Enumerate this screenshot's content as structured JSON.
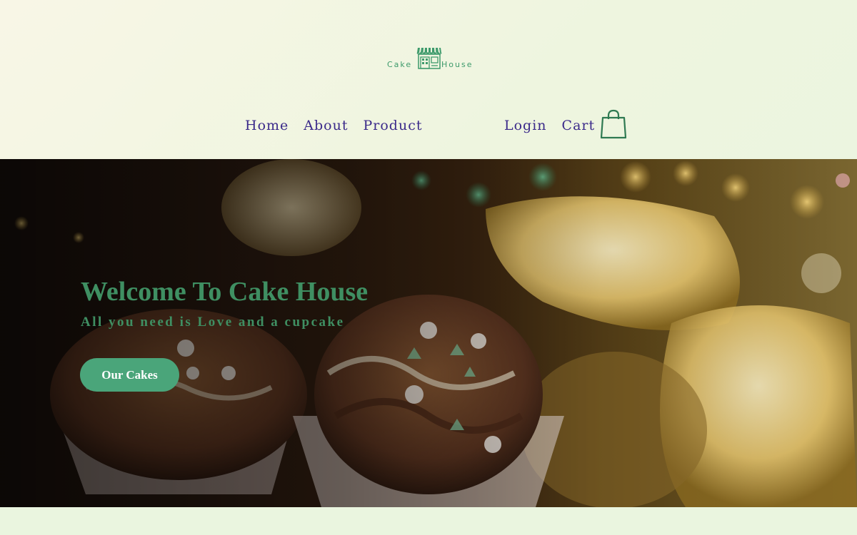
{
  "logo": {
    "left_word": "Cake",
    "right_word": "House",
    "icon": "shop-storefront-icon"
  },
  "nav": {
    "left": [
      {
        "label": "Home"
      },
      {
        "label": "About"
      },
      {
        "label": "Product"
      }
    ],
    "right": [
      {
        "label": "Login"
      },
      {
        "label": "Cart"
      }
    ],
    "cart_icon": "shopping-bag-icon"
  },
  "hero": {
    "title": "Welcome To Cake House",
    "subtitle": "All you need is Love and a cupcake",
    "cta_label": "Our Cakes"
  },
  "colors": {
    "brand_green": "#3f8f62",
    "button_green": "#4aa57a",
    "nav_text": "#3b2a8a",
    "background": "#eef5df"
  }
}
